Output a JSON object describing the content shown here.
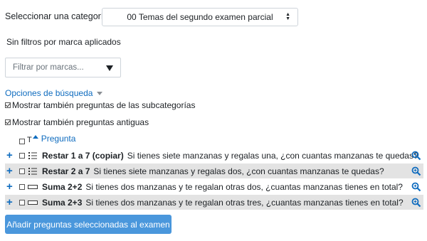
{
  "category": {
    "label": "Seleccionar una categoría:",
    "selected": "00 Temas del segundo examen parcial"
  },
  "filters": {
    "no_filter_text": "Sin filtros por marca aplicados",
    "tag_placeholder": "Filtrar por marcas..."
  },
  "search_options": {
    "label": "Opciones de búsqueda",
    "show_subcategories": "Mostrar también preguntas de las subcategorías",
    "show_old": "Mostrar también preguntas antiguas"
  },
  "table": {
    "col_type": "T",
    "col_question": "Pregunta"
  },
  "questions": [
    {
      "name": "Restar 1 a 7 (copiar)",
      "text": "Si tienes siete manzanas y regalas una, ¿con cuantas manzanas te quedas?",
      "type_icon": "multichoice-icon"
    },
    {
      "name": "Restar 2 a 7",
      "text": "Si tienes siete manzanas y regalas dos, ¿con cuantas manzanas te quedas?",
      "type_icon": "multichoice-icon"
    },
    {
      "name": "Suma 2+2",
      "text": "Si tienes dos manzanas y te regalan otras dos, ¿cuantas manzanas tienes en total?",
      "type_icon": "shortanswer-icon"
    },
    {
      "name": "Suma 2+3",
      "text": "Si tienes dos manzanas y te regalan otras tres, ¿cuantas manzanas tienes en total?",
      "type_icon": "shortanswer-icon"
    }
  ],
  "add_button": "Añadir preguntas seleccionadas al examen",
  "colors": {
    "link": "#0f6cbf",
    "row_shade": "#e3e3e3",
    "button_bg": "#4a97dc",
    "button_text": "#ffffff"
  }
}
